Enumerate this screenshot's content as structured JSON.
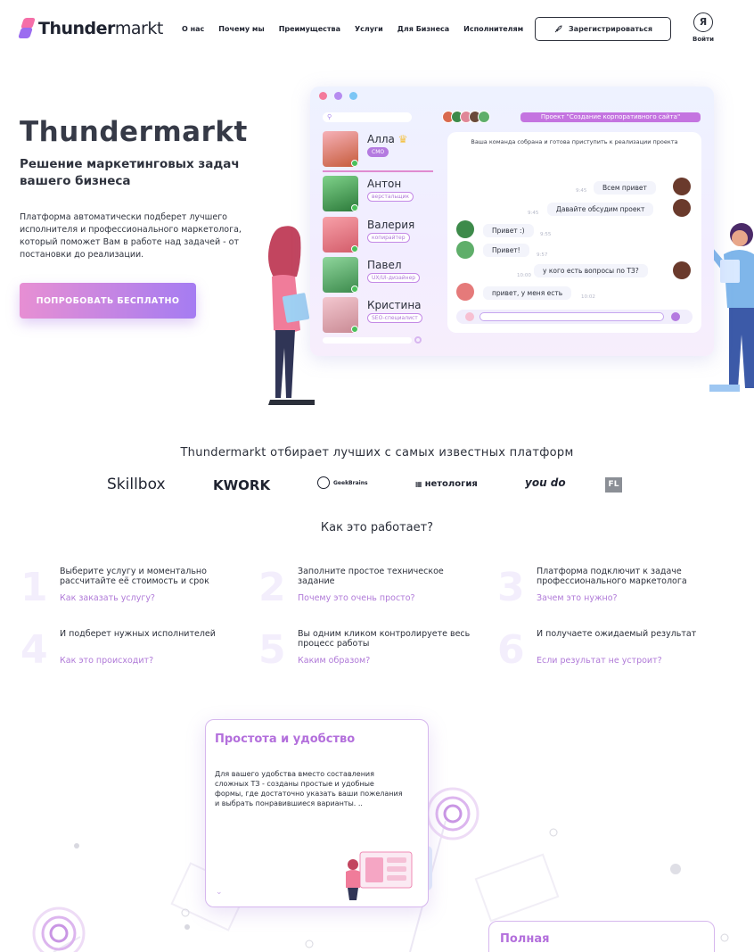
{
  "header": {
    "logo_bold": "Thunder",
    "logo_light": "markt",
    "nav": [
      "О нас",
      "Почему мы",
      "Преимущества",
      "Услуги",
      "Для Бизнеса",
      "Исполнителям"
    ],
    "register_label": "Зарегистрироваться",
    "login_icon": "Я",
    "login_label": "Войти"
  },
  "hero": {
    "title": "Thundermarkt",
    "subtitle": "Решение маркетинговых задач вашего бизнеса",
    "description": "Платформа автоматически подберет лучшего исполнителя и профессионального маркетолога, который поможет Вам в работе над задачей - от постановки до реализации.",
    "cta_label": "ПОПРОБОВАТЬ БЕСПЛАТНО"
  },
  "chat_window": {
    "project_label": "Проект \"Создание корпоративного сайта\"",
    "team_notice": "Ваша команда собрана и готова приступить к реализации проекта",
    "members": [
      {
        "name": "Алла",
        "role": "CMO"
      },
      {
        "name": "Антон",
        "role": "верстальщик"
      },
      {
        "name": "Валерия",
        "role": "копирайтер"
      },
      {
        "name": "Павел",
        "role": "UX/UI-дизайнер"
      },
      {
        "name": "Кристина",
        "role": "SEO-специалист"
      }
    ],
    "messages": [
      {
        "text": "Всем привет",
        "time": "9:45"
      },
      {
        "text": "Давайте обсудим проект",
        "time": "9:45"
      },
      {
        "text": "Привет :)",
        "time": "9:55"
      },
      {
        "text": "Привет!",
        "time": "9:57"
      },
      {
        "text": "у кого есть вопросы по ТЗ?",
        "time": "10:00"
      },
      {
        "text": "привет, у меня есть",
        "time": "10:02"
      }
    ],
    "colors": {
      "dot1": "#f47a9c",
      "dot2": "#b68cf0",
      "dot3": "#7cc6f5",
      "accent": "#c474e0"
    }
  },
  "partners": {
    "title": "Thundermarkt отбирает лучших с самых известных платформ",
    "logos": [
      "Skillbox",
      "KWORK",
      "GeekBrains",
      "нетология",
      "you do",
      "FL"
    ]
  },
  "how": {
    "title": "Как это работает?",
    "steps": [
      {
        "num": "1",
        "text": "Выберите услугу и моментально рассчитайте её стоимость и срок",
        "link": "Как заказать услугу?"
      },
      {
        "num": "2",
        "text": "Заполните простое техническое задание",
        "link": "Почему это очень просто?"
      },
      {
        "num": "3",
        "text": "Платформа подключит к задаче профессионального маркетолога",
        "link": "Зачем это нужно?"
      },
      {
        "num": "4",
        "text": "И подберет нужных исполнителей",
        "link": "Как это происходит?"
      },
      {
        "num": "5",
        "text": "Вы одним кликом контролируете весь процесс работы",
        "link": "Каким образом?"
      },
      {
        "num": "6",
        "text": "И получаете ожидаемый результат",
        "link": "Если результат не устроит?"
      }
    ]
  },
  "features": {
    "card1_title": "Простота и удобство",
    "card1_text": "Для вашего удобства вместо составления сложных ТЗ - созданы простые и удобные формы, где достаточно указать ваши пожелания и выбрать понравившиеся варианты. ..",
    "card2_title": "Полная"
  }
}
